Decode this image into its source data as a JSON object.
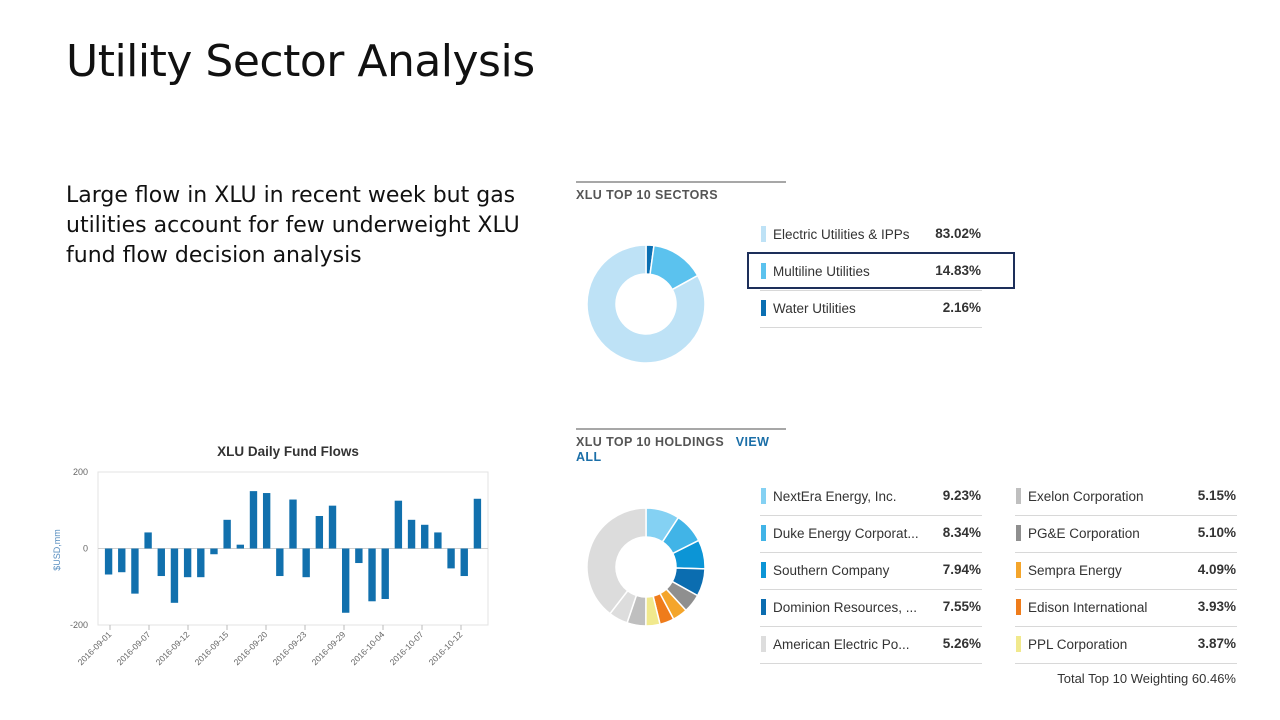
{
  "slide": {
    "title": "Utility Sector Analysis",
    "body_lines": [
      "Large flow in XLU in recent week but gas",
      "utilities account for few underweight XLU",
      "fund flow decision analysis"
    ]
  },
  "sectors_widget": {
    "title": "XLU TOP 10 SECTORS",
    "rows": [
      {
        "name": "Electric Utilities & IPPs",
        "pct": "83.02%",
        "value": 83.02,
        "color": "#bee2f6"
      },
      {
        "name": "Multiline Utilities",
        "pct": "14.83%",
        "value": 14.83,
        "color": "#5bc2ee"
      },
      {
        "name": "Water Utilities",
        "pct": "2.16%",
        "value": 2.16,
        "color": "#0a6fb2"
      }
    ],
    "highlighted_row": "Multiline Utilities"
  },
  "holdings_widget": {
    "title": "XLU TOP 10 HOLDINGS",
    "link": "VIEW ALL",
    "left_rows": [
      {
        "name": "NextEra Energy, Inc.",
        "pct": "9.23%",
        "value": 9.23,
        "color": "#84d1f3"
      },
      {
        "name": "Duke Energy Corporat...",
        "pct": "8.34%",
        "value": 8.34,
        "color": "#41b4e7"
      },
      {
        "name": "Southern Company",
        "pct": "7.94%",
        "value": 7.94,
        "color": "#0c95d6"
      },
      {
        "name": "Dominion Resources, ...",
        "pct": "7.55%",
        "value": 7.55,
        "color": "#0b6db0"
      },
      {
        "name": "American Electric Po...",
        "pct": "5.26%",
        "value": 5.26,
        "color": "#dddddd"
      }
    ],
    "right_rows": [
      {
        "name": "Exelon Corporation",
        "pct": "5.15%",
        "value": 5.15,
        "color": "#bfbfbf"
      },
      {
        "name": "PG&E Corporation",
        "pct": "5.10%",
        "value": 5.1,
        "color": "#8f8f8f"
      },
      {
        "name": "Sempra Energy",
        "pct": "4.09%",
        "value": 4.09,
        "color": "#f4a52b"
      },
      {
        "name": "Edison International",
        "pct": "3.93%",
        "value": 3.93,
        "color": "#ef7c1b"
      },
      {
        "name": "PPL Corporation",
        "pct": "3.87%",
        "value": 3.87,
        "color": "#f1e98d"
      }
    ],
    "remainder_color": "#dcdcdc",
    "total_label": "Total Top 10 Weighting 60.46%"
  },
  "chart_data": {
    "type": "bar",
    "title": "XLU Daily Fund Flows",
    "ylabel": "$USD,mm",
    "xlabel": "",
    "ylim": [
      -200,
      200
    ],
    "yticks": [
      200,
      0,
      -200
    ],
    "bar_color": "#1170ad",
    "x_tick_labels": [
      "2016-09-01",
      "2016-09-07",
      "2016-09-12",
      "2016-09-15",
      "2016-09-20",
      "2016-09-23",
      "2016-09-29",
      "2016-10-04",
      "2016-10-07",
      "2016-10-12"
    ],
    "values": [
      -68,
      -62,
      -118,
      42,
      -72,
      -142,
      -75,
      -75,
      -15,
      75,
      10,
      150,
      145,
      -72,
      128,
      -75,
      85,
      112,
      -168,
      -38,
      -138,
      -132,
      125,
      75,
      62,
      42,
      -52,
      -72,
      130
    ]
  }
}
